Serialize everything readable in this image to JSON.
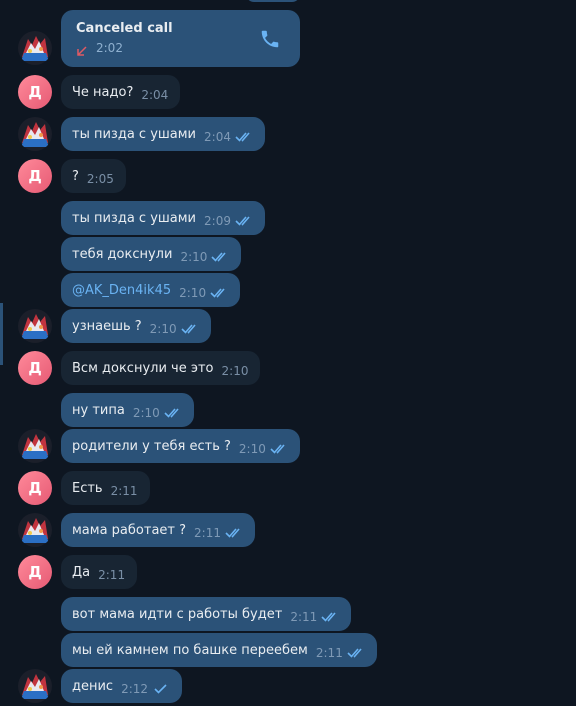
{
  "chat": {
    "call": {
      "title": "Canceled call",
      "time": "2:02",
      "icon": "missed-call-arrow-icon",
      "action_icon": "phone-icon"
    },
    "contact_initial": "Д",
    "messages": [
      {
        "dir": "in",
        "text": "Че надо?",
        "time": "2:04"
      },
      {
        "dir": "out",
        "text": "ты пизда с ушами",
        "time": "2:04"
      },
      {
        "dir": "in",
        "text": "?",
        "time": "2:05"
      },
      {
        "dir": "out",
        "text": "ты пизда с ушами",
        "time": "2:09"
      },
      {
        "dir": "out",
        "text": "тебя докснули",
        "time": "2:10"
      },
      {
        "dir": "out",
        "text": "@AK_Den4ik45",
        "time": "2:10",
        "link": true
      },
      {
        "dir": "out",
        "text": "узнаешь ?",
        "time": "2:10"
      },
      {
        "dir": "in",
        "text": "Всм докснули че это",
        "time": "2:10"
      },
      {
        "dir": "out",
        "text": "ну типа",
        "time": "2:10"
      },
      {
        "dir": "out",
        "text": "родители у тебя есть ?",
        "time": "2:10"
      },
      {
        "dir": "in",
        "text": "Есть",
        "time": "2:11"
      },
      {
        "dir": "out",
        "text": "мама работает ?",
        "time": "2:11"
      },
      {
        "dir": "in",
        "text": "Да",
        "time": "2:11"
      },
      {
        "dir": "out",
        "text": "вот мама идти с работы будет",
        "time": "2:11"
      },
      {
        "dir": "out",
        "text": "мы ей камнем по башке переебем",
        "time": "2:11"
      },
      {
        "dir": "out",
        "text": "денис",
        "time": "2:12",
        "single_tick": true
      }
    ]
  },
  "colors": {
    "background": "#0e1621",
    "incoming_bubble": "#182533",
    "outgoing_bubble": "#2b5278",
    "link": "#6ab3f3",
    "read_ticks": "#6ab3f3",
    "missed_call": "#e05a64",
    "contact_avatar": "#e65a74"
  }
}
